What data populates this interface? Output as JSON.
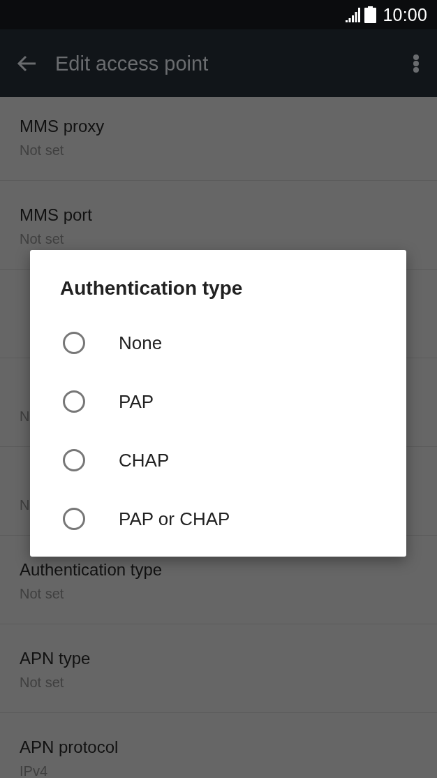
{
  "status_bar": {
    "time": "10:00"
  },
  "app_bar": {
    "title": "Edit access point"
  },
  "settings": [
    {
      "title": "MMS proxy",
      "value": "Not set"
    },
    {
      "title": "MMS port",
      "value": "Not set"
    }
  ],
  "settings_behind_dialog": [
    {
      "value": "N"
    },
    {
      "value": "N"
    }
  ],
  "settings_below_dialog": [
    {
      "title": "Authentication type",
      "value": "Not set"
    },
    {
      "title": "APN type",
      "value": "Not set"
    },
    {
      "title": "APN protocol",
      "value": "IPv4"
    }
  ],
  "dialog": {
    "title": "Authentication type",
    "options": [
      {
        "label": "None",
        "selected": false
      },
      {
        "label": "PAP",
        "selected": false
      },
      {
        "label": "CHAP",
        "selected": false
      },
      {
        "label": "PAP or CHAP",
        "selected": false
      }
    ]
  }
}
